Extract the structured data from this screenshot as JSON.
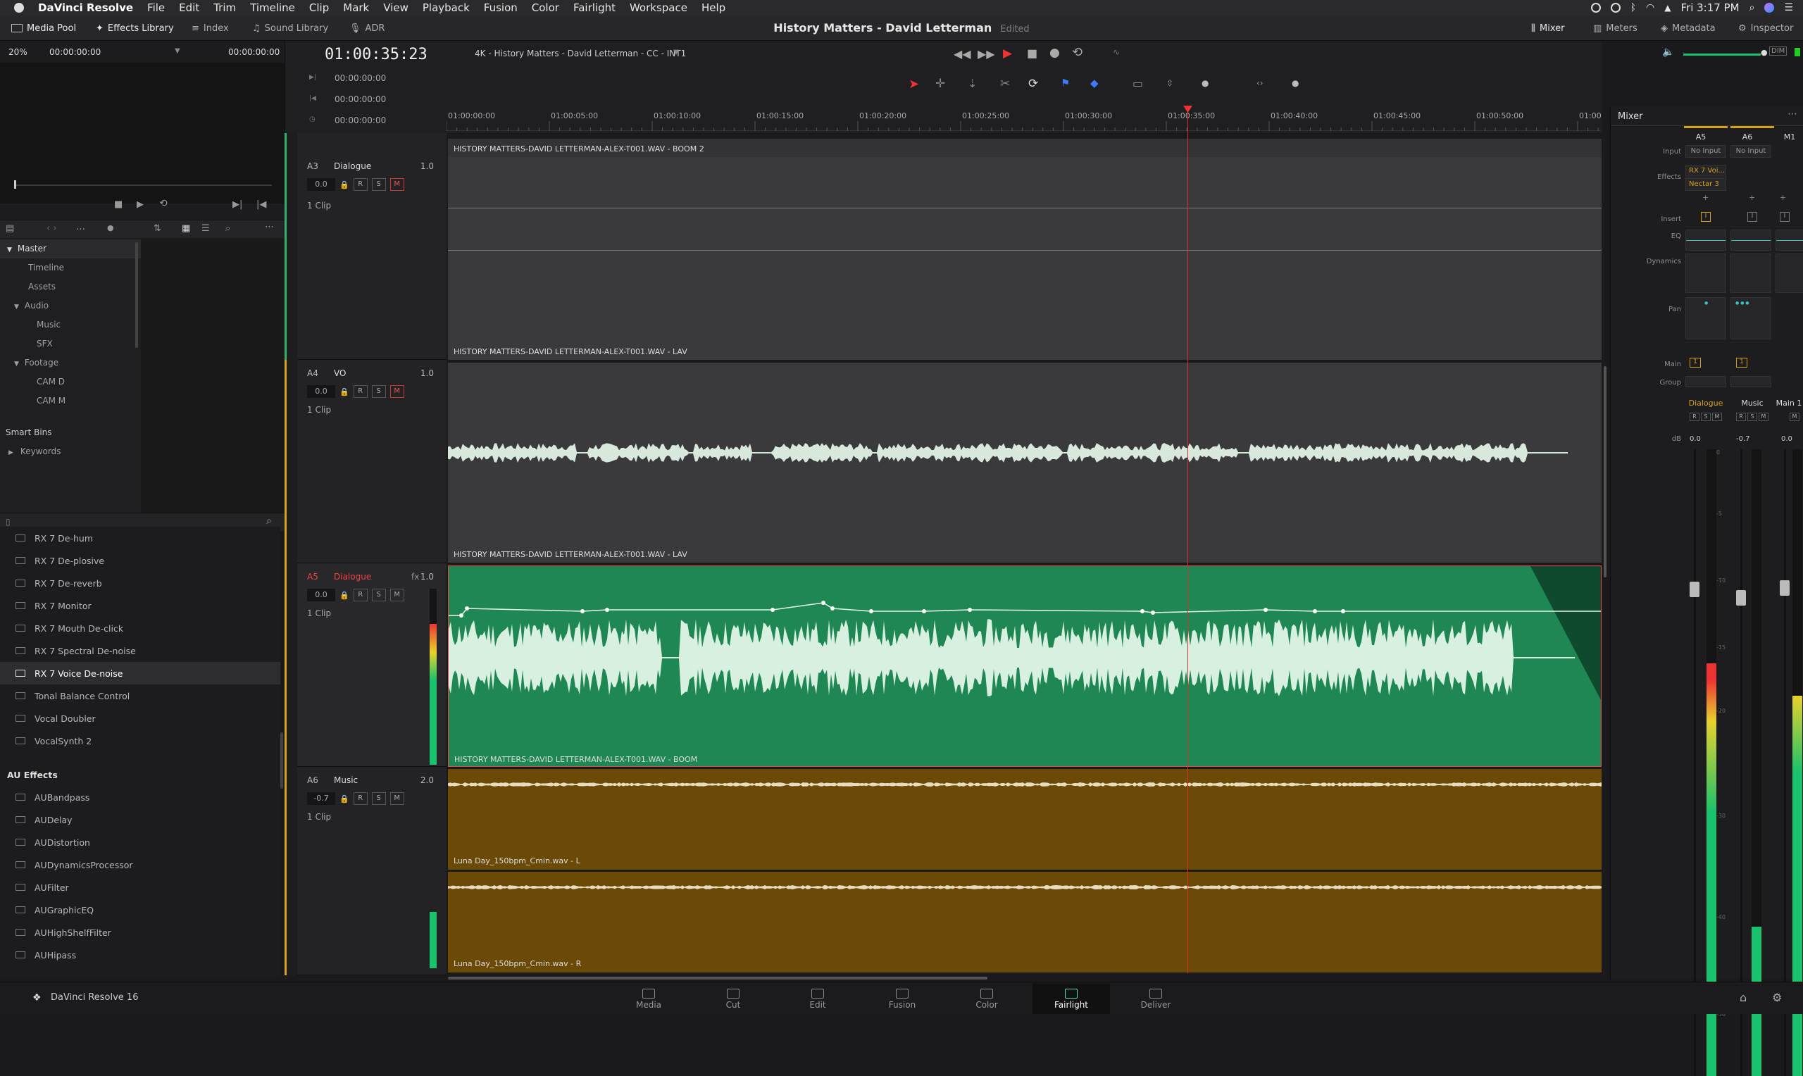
{
  "menubar": {
    "apple": "",
    "app": "DaVinci Resolve",
    "items": [
      "File",
      "Edit",
      "Trim",
      "Timeline",
      "Clip",
      "Mark",
      "View",
      "Playback",
      "Fusion",
      "Color",
      "Fairlight",
      "Workspace",
      "Help"
    ],
    "clock": "Fri 3:17 PM"
  },
  "toolbar": {
    "media_pool": "Media Pool",
    "effects_library": "Effects Library",
    "index": "Index",
    "sound_library": "Sound Library",
    "adr": "ADR",
    "project_title": "History Matters - David Letterman",
    "edited": "Edited",
    "mixer": "Mixer",
    "meters": "Meters",
    "metadata": "Metadata",
    "inspector": "Inspector"
  },
  "viewer": {
    "zoom": "20%",
    "tc_left": "00:00:00:00",
    "tc_right": "00:00:00:00"
  },
  "transport": {
    "main_tc": "01:00:35:23",
    "timeline_name": "4K - History Matters - David Letterman - CC - INT1",
    "tc_in": "00:00:00:00",
    "tc_out": "00:00:00:00",
    "tc_dur": "00:00:00:00"
  },
  "bins": {
    "master": "Master",
    "items": [
      "Timeline",
      "Assets",
      "Audio",
      "Music",
      "SFX",
      "Footage",
      "CAM D",
      "CAM M"
    ],
    "smart_bins": "Smart Bins",
    "keywords": "Keywords"
  },
  "effects": {
    "vst": [
      "RX 7 De-hum",
      "RX 7 De-plosive",
      "RX 7 De-reverb",
      "RX 7 Monitor",
      "RX 7 Mouth De-click",
      "RX 7 Spectral De-noise",
      "RX 7 Voice De-noise",
      "Tonal Balance Control",
      "Vocal Doubler",
      "VocalSynth 2"
    ],
    "au_header": "AU Effects",
    "au": [
      "AUBandpass",
      "AUDelay",
      "AUDistortion",
      "AUDynamicsProcessor",
      "AUFilter",
      "AUGraphicEQ",
      "AUHighShelfFilter",
      "AUHipass"
    ]
  },
  "ruler": [
    "01:00:00:00",
    "01:00:05:00",
    "01:00:10:00",
    "01:00:15:00",
    "01:00:20:00",
    "01:00:25:00",
    "01:00:30:00",
    "01:00:35:00",
    "01:00:40:00",
    "01:00:45:00",
    "01:00:50:00",
    "01:00"
  ],
  "tracks": [
    {
      "id": "A3",
      "name": "Dialogue",
      "vol": "1.0",
      "gain": "0.0",
      "clips": "1 Clip",
      "clip_top": "HISTORY MATTERS-DAVID LETTERMAN-ALEX-T001.WAV - BOOM 2",
      "clip_bottom": "HISTORY MATTERS-DAVID LETTERMAN-ALEX-T001.WAV - LAV"
    },
    {
      "id": "A4",
      "name": "VO",
      "vol": "1.0",
      "gain": "0.0",
      "clips": "1 Clip",
      "clip_bottom": "HISTORY MATTERS-DAVID LETTERMAN-ALEX-T001.WAV - LAV"
    },
    {
      "id": "A5",
      "name": "Dialogue",
      "vol": "1.0",
      "gain": "0.0",
      "clips": "1 Clip",
      "fx": "fx",
      "clip_bottom": "HISTORY MATTERS-DAVID LETTERMAN-ALEX-T001.WAV - BOOM"
    },
    {
      "id": "A6",
      "name": "Music",
      "vol": "2.0",
      "gain": "-0.7",
      "clips": "1 Clip",
      "clip_l": "Luna Day_150bpm_Cmin.wav - L",
      "clip_r": "Luna Day_150bpm_Cmin.wav - R"
    }
  ],
  "mixer": {
    "title": "Mixer",
    "cols": [
      "A5",
      "A6",
      "M1"
    ],
    "input": "Input",
    "no_input": "No Input",
    "effects": "Effects",
    "fx1": "RX 7 Voi...",
    "fx2": "Nectar 3",
    "insert": "Insert",
    "eq": "EQ",
    "dynamics": "Dynamics",
    "pan": "Pan",
    "main": "Main",
    "group": "Group",
    "names": [
      "Dialogue",
      "Music",
      "Main 1"
    ],
    "db": "dB",
    "levels": [
      "0.0",
      "-0.7",
      "0.0"
    ],
    "scale": [
      "0",
      "-5",
      "-10",
      "-15",
      "-20",
      "-30",
      "-40",
      "-50"
    ]
  },
  "pages": [
    "Media",
    "Cut",
    "Edit",
    "Fusion",
    "Color",
    "Fairlight",
    "Deliver"
  ],
  "footer": {
    "app": "DaVinci Resolve 16"
  }
}
